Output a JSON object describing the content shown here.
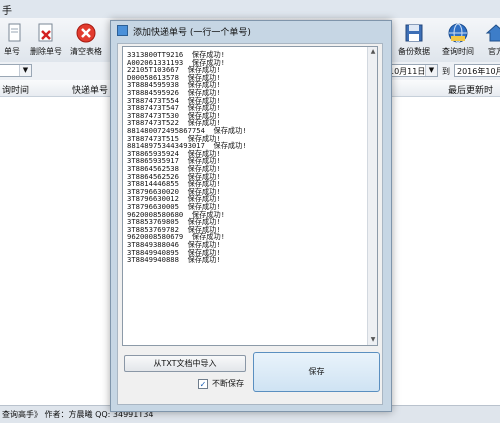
{
  "app": {
    "title_fragment": "手",
    "toolbar": {
      "left_label": "单号",
      "delete_label": "删除单号",
      "clear_label": "清空表格",
      "backup_label": "备份数据",
      "query_label": "查询时间",
      "right_label": "官方"
    },
    "filters": {
      "date_from": "10月11日",
      "date_label": "到",
      "date_to": "2016年10月1"
    },
    "grid": {
      "columns": [
        "询时间",
        "快递单号",
        "最后更新时间"
      ]
    },
    "statusbar": {
      "text": "查询高手》 作者：方晨曦  QQ: 34991T34"
    }
  },
  "dialog": {
    "title": "添加快递单号 (一行一个单号)",
    "lines": [
      "3313800TT9216  保存成功!",
      "A002061331193  保存成功!",
      "22105T103667  保存成功!",
      "D00058613578  保存成功!",
      "3T8884595938  保存成功!",
      "3T8884595926  保存成功!",
      "3T887473T554  保存成功!",
      "3T887473T547  保存成功!",
      "3T887473T530  保存成功!",
      "3T887473T522  保存成功!",
      "881480072495867754  保存成功!",
      "3T887473T515  保存成功!",
      "881489753443493017  保存成功!",
      "3T8865935924  保存成功!",
      "3T8865935917  保存成功!",
      "3T8864562538  保存成功!",
      "3T8864562526  保存成功!",
      "3T8814446855  保存成功!",
      "3T8796630020  保存成功!",
      "3T8796630012  保存成功!",
      "3T8796630005  保存成功!",
      "9620008580680  保存成功!",
      "3T8853769805  保存成功!",
      "3T8853769782  保存成功!",
      "9620008580679  保存成功!",
      "3T8849388046  保存成功!",
      "3T8849940895  保存成功!",
      "3T8849940888  保存成功!"
    ],
    "import_button": "从TXT文档中导入",
    "keep_saving_label": "不断保存",
    "keep_saving_checked": "✓",
    "save_button": "保存"
  }
}
